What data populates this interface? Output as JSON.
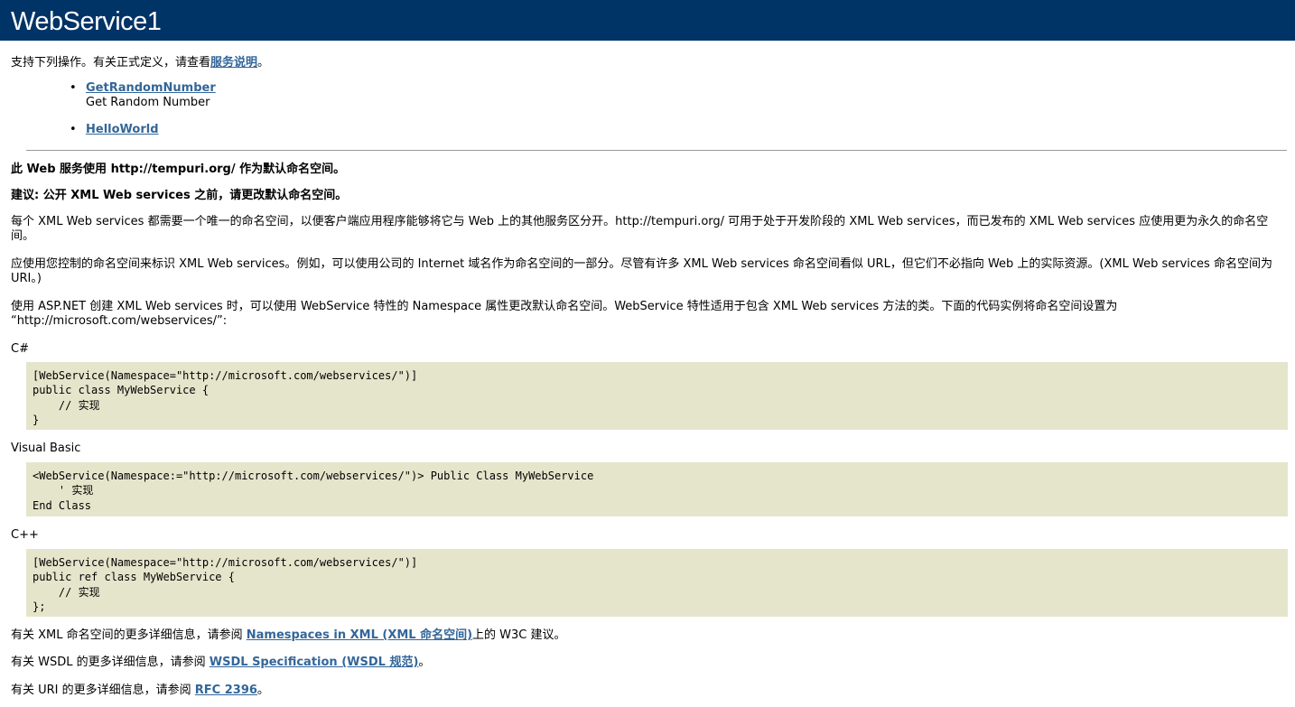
{
  "header": {
    "title": "WebService1"
  },
  "intro": {
    "text": "支持下列操作。有关正式定义，请查看",
    "link": "服务说明",
    "suffix": "。"
  },
  "operations": [
    {
      "name": "GetRandomNumber",
      "description": "Get Random Number"
    },
    {
      "name": "HelloWorld",
      "description": ""
    }
  ],
  "notice": {
    "namespace_line": "此 Web 服务使用 http://tempuri.org/ 作为默认命名空间。",
    "recommendation": "建议: 公开 XML Web services 之前，请更改默认命名空间。",
    "para1": "每个 XML Web services 都需要一个唯一的命名空间，以便客户端应用程序能够将它与 Web 上的其他服务区分开。http://tempuri.org/ 可用于处于开发阶段的 XML Web services，而已发布的 XML Web services 应使用更为永久的命名空间。",
    "para2": "应使用您控制的命名空间来标识 XML Web services。例如，可以使用公司的 Internet 域名作为命名空间的一部分。尽管有许多 XML Web services 命名空间看似 URL，但它们不必指向 Web 上的实际资源。(XML Web services 命名空间为 URI。)",
    "para3": "使用 ASP.NET 创建 XML Web services 时，可以使用 WebService 特性的 Namespace 属性更改默认命名空间。WebService 特性适用于包含 XML Web services 方法的类。下面的代码实例将命名空间设置为 “http://microsoft.com/webservices/”:"
  },
  "code_samples": [
    {
      "language": "C#",
      "code": "[WebService(Namespace=\"http://microsoft.com/webservices/\")]\npublic class MyWebService {\n    // 实现\n}"
    },
    {
      "language": "Visual Basic",
      "code": "<WebService(Namespace:=\"http://microsoft.com/webservices/\")> Public Class MyWebService\n    ' 实现\nEnd Class"
    },
    {
      "language": "C++",
      "code": "[WebService(Namespace=\"http://microsoft.com/webservices/\")]\npublic ref class MyWebService {\n    // 实现\n};"
    }
  ],
  "more_info": [
    {
      "prefix": "有关 XML 命名空间的更多详细信息，请参阅 ",
      "link": "Namespaces in XML (XML 命名空间)",
      "suffix": "上的 W3C 建议。"
    },
    {
      "prefix": "有关 WSDL 的更多详细信息，请参阅 ",
      "link": "WSDL Specification (WSDL 规范)",
      "suffix": "。"
    },
    {
      "prefix": "有关 URI 的更多详细信息，请参阅 ",
      "link": "RFC 2396",
      "suffix": "。"
    }
  ],
  "colors": {
    "header_bg": "#003366",
    "link": "#336699",
    "code_bg": "#e5e5cc"
  }
}
